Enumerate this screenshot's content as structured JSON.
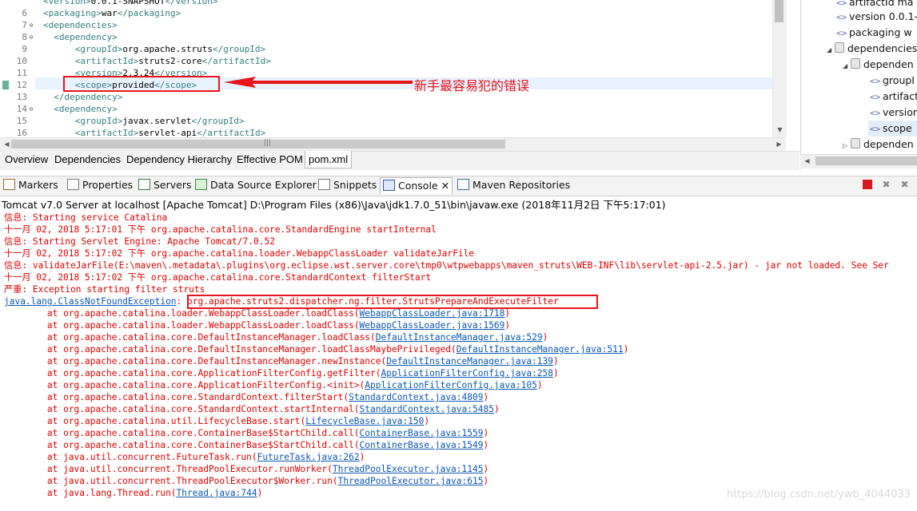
{
  "editor": {
    "lines": [
      {
        "num": "",
        "fold": "",
        "text": "<version>0.0.1-SNAPSHOT</version>"
      },
      {
        "num": "6",
        "fold": "",
        "text": "<packaging>war</packaging>"
      },
      {
        "num": "7",
        "fold": "⊖",
        "text": "<dependencies>"
      },
      {
        "num": "8",
        "fold": "⊖",
        "text": "  <dependency>"
      },
      {
        "num": "9",
        "fold": "",
        "text": "      <groupId>org.apache.struts</groupId>"
      },
      {
        "num": "10",
        "fold": "",
        "text": "      <artifactId>struts2-core</artifactId>"
      },
      {
        "num": "11",
        "fold": "",
        "text": "      <version>2.3.24</version>"
      },
      {
        "num": "12",
        "fold": "",
        "text": "      <scope>provided</scope>"
      },
      {
        "num": "13",
        "fold": "",
        "text": "  </dependency>"
      },
      {
        "num": "14",
        "fold": "⊖",
        "text": "  <dependency>"
      },
      {
        "num": "15",
        "fold": "",
        "text": "      <groupId>javax.servlet</groupId>"
      },
      {
        "num": "16",
        "fold": "",
        "text": "      <artifactId>servlet-api</artifactId>"
      }
    ],
    "scroll_grip": "|||",
    "tabs": [
      {
        "label": "Overview"
      },
      {
        "label": "Dependencies"
      },
      {
        "label": "Dependency Hierarchy"
      },
      {
        "label": "Effective POM"
      },
      {
        "label": "pom.xml"
      }
    ]
  },
  "outline": {
    "items": [
      {
        "icon": "<>",
        "label": "artifactId  ma"
      },
      {
        "icon": "<>",
        "label": "version  0.0.1-"
      },
      {
        "icon": "<>",
        "label": "packaging  w"
      },
      {
        "icon": "bag",
        "label": "dependencies"
      },
      {
        "icon": "bag",
        "label": "dependen"
      },
      {
        "icon": "<>",
        "label": "groupI"
      },
      {
        "icon": "<>",
        "label": "artifact"
      },
      {
        "icon": "<>",
        "label": "version"
      },
      {
        "icon": "<>",
        "label": "scope"
      },
      {
        "icon": "bag",
        "label": "dependen"
      }
    ]
  },
  "views": {
    "tabs": [
      {
        "label": "Markers"
      },
      {
        "label": "Properties"
      },
      {
        "label": "Servers"
      },
      {
        "label": "Data Source Explorer"
      },
      {
        "label": "Snippets"
      },
      {
        "label": "Console ✕"
      },
      {
        "label": "Maven Repositories"
      }
    ]
  },
  "console": {
    "title": "Tomcat v7.0 Server at localhost [Apache Tomcat] D:\\Program Files (x86)\\Java\\jdk1.7.0_51\\bin\\javaw.exe (2018年11月2日 下午5:17:01)",
    "lines": [
      {
        "pre": "信息: Starting service Catalina",
        "link": "",
        "post": ""
      },
      {
        "pre": "十一月 02, 2018 5:17:01 下午 org.apache.catalina.core.StandardEngine startInternal",
        "link": "",
        "post": ""
      },
      {
        "pre": "信息: Starting Servlet Engine: Apache Tomcat/7.0.52",
        "link": "",
        "post": ""
      },
      {
        "pre": "十一月 02, 2018 5:17:02 下午 org.apache.catalina.loader.WebappClassLoader validateJarFile",
        "link": "",
        "post": ""
      },
      {
        "pre": "信息: validateJarFile(E:\\maven\\.metadata\\.plugins\\org.eclipse.wst.server.core\\tmp0\\wtpwebapps\\maven_struts\\WEB-INF\\lib\\servlet-api-2.5.jar) - jar not loaded. See Ser",
        "link": "",
        "post": ""
      },
      {
        "pre": "十一月 02, 2018 5:17:02 下午 org.apache.catalina.core.StandardContext filterStart",
        "link": "",
        "post": ""
      },
      {
        "pre": "严重: Exception starting filter struts",
        "link": "",
        "post": ""
      },
      {
        "pre": "",
        "link": "java.lang.ClassNotFoundException",
        "post": ": org.apache.struts2.dispatcher.ng.filter.StrutsPrepareAndExecuteFilter"
      },
      {
        "pre": "        at org.apache.catalina.loader.WebappClassLoader.loadClass(",
        "link": "WebappClassLoader.java:1718",
        "post": ")"
      },
      {
        "pre": "        at org.apache.catalina.loader.WebappClassLoader.loadClass(",
        "link": "WebappClassLoader.java:1569",
        "post": ")"
      },
      {
        "pre": "        at org.apache.catalina.core.DefaultInstanceManager.loadClass(",
        "link": "DefaultInstanceManager.java:529",
        "post": ")"
      },
      {
        "pre": "        at org.apache.catalina.core.DefaultInstanceManager.loadClassMaybePrivileged(",
        "link": "DefaultInstanceManager.java:511",
        "post": ")"
      },
      {
        "pre": "        at org.apache.catalina.core.DefaultInstanceManager.newInstance(",
        "link": "DefaultInstanceManager.java:139",
        "post": ")"
      },
      {
        "pre": "        at org.apache.catalina.core.ApplicationFilterConfig.getFilter(",
        "link": "ApplicationFilterConfig.java:258",
        "post": ")"
      },
      {
        "pre": "        at org.apache.catalina.core.ApplicationFilterConfig.<init>(",
        "link": "ApplicationFilterConfig.java:105",
        "post": ")"
      },
      {
        "pre": "        at org.apache.catalina.core.StandardContext.filterStart(",
        "link": "StandardContext.java:4809",
        "post": ")"
      },
      {
        "pre": "        at org.apache.catalina.core.StandardContext.startInternal(",
        "link": "StandardContext.java:5485",
        "post": ")"
      },
      {
        "pre": "        at org.apache.catalina.util.LifecycleBase.start(",
        "link": "LifecycleBase.java:150",
        "post": ")"
      },
      {
        "pre": "        at org.apache.catalina.core.ContainerBase$StartChild.call(",
        "link": "ContainerBase.java:1559",
        "post": ")"
      },
      {
        "pre": "        at org.apache.catalina.core.ContainerBase$StartChild.call(",
        "link": "ContainerBase.java:1549",
        "post": ")"
      },
      {
        "pre": "        at java.util.concurrent.FutureTask.run(",
        "link": "FutureTask.java:262",
        "post": ")"
      },
      {
        "pre": "        at java.util.concurrent.ThreadPoolExecutor.runWorker(",
        "link": "ThreadPoolExecutor.java:1145",
        "post": ")"
      },
      {
        "pre": "        at java.util.concurrent.ThreadPoolExecutor$Worker.run(",
        "link": "ThreadPoolExecutor.java:615",
        "post": ")"
      },
      {
        "pre": "        at java.lang.Thread.run(",
        "link": "Thread.java:744",
        "post": ")"
      }
    ]
  },
  "annotation": {
    "text": "新手最容易犯的错误"
  },
  "watermark": "https://blog.csdn.net/ywb_4044033",
  "colors": {
    "annotation_red": "#e8141b",
    "console_error": "#e00000",
    "console_link": "#0b58b4",
    "xml_tag": "#2f7f7f"
  }
}
